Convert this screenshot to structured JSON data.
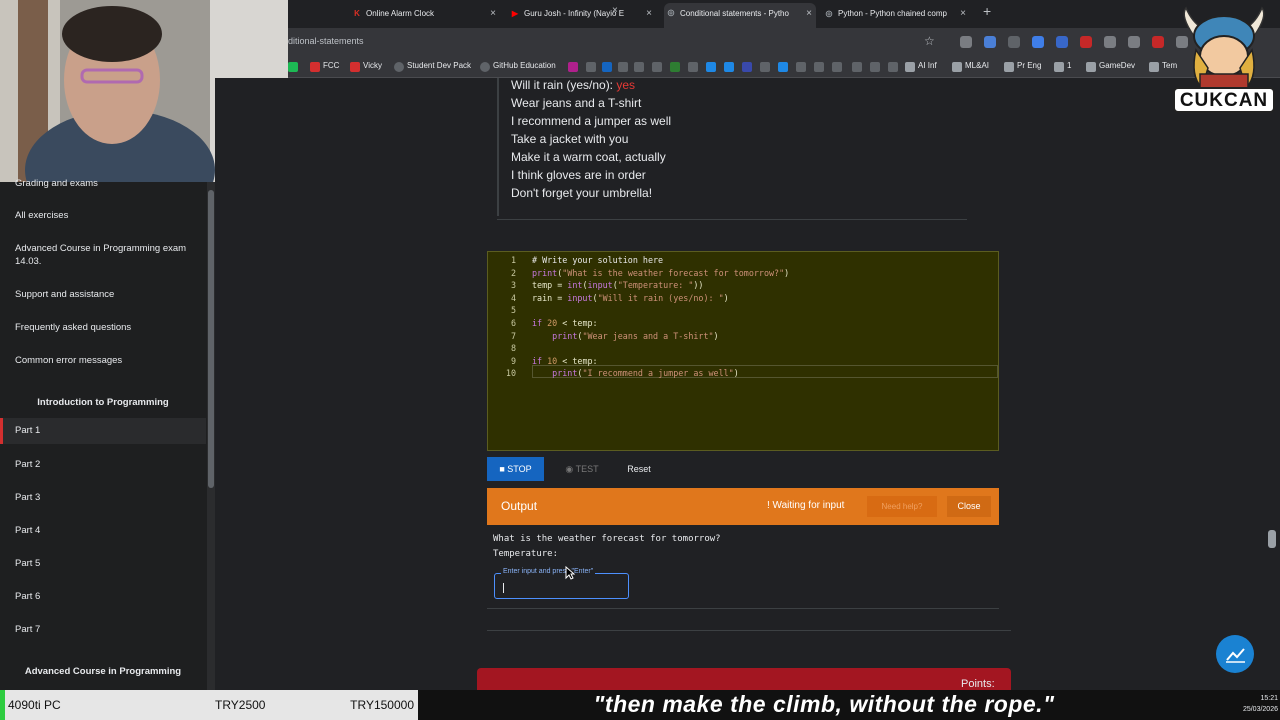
{
  "browser": {
    "tabs": [
      {
        "label": "Online Alarm Clock",
        "favicon": "K",
        "color": "#d93025"
      },
      {
        "label": "Guru Josh - Infinity (Nayio E",
        "favicon": "▶",
        "color": "#ff0000"
      },
      {
        "label": "Conditional statements - Pytho",
        "favicon": "◎",
        "color": "#9aa0a6"
      },
      {
        "label": "Python - Python chained comp",
        "favicon": "◎",
        "color": "#9aa0a6"
      }
    ],
    "close_glyph": "×",
    "new_tab": "+",
    "url": "ditional-statements",
    "star": "☆",
    "bookmarks": [
      "FCC",
      "Vicky",
      "Student Dev Pack",
      "GitHub Education",
      "AI Inf",
      "ML&AI",
      "Pr Eng",
      "1",
      "GameDev",
      "Tem"
    ]
  },
  "sidebar": {
    "items_top": [
      {
        "label": "Grading and exams"
      },
      {
        "label": "All exercises"
      },
      {
        "label": "Advanced Course in Programming exam 14.03."
      },
      {
        "label": "Support and assistance"
      },
      {
        "label": "Frequently asked questions"
      },
      {
        "label": "Common error messages"
      }
    ],
    "section_title": "Introduction to Programming",
    "parts": [
      "Part 1",
      "Part 2",
      "Part 3",
      "Part 4",
      "Part 5",
      "Part 6",
      "Part 7"
    ],
    "section_title_2": "Advanced Course in Programming"
  },
  "sample_output": {
    "prompt_line": "Will it rain (yes/no): ",
    "prompt_answer": "yes",
    "lines": [
      "Wear jeans and a T-shirt",
      "I recommend a jumper as well",
      "Take a jacket with you",
      "Make it a warm coat, actually",
      "I think gloves are in order",
      "Don't forget your umbrella!"
    ]
  },
  "editor": {
    "line_numbers": [
      "1",
      "2",
      "3",
      "4",
      "5",
      "6",
      "7",
      "8",
      "9",
      "10"
    ]
  },
  "controls": {
    "stop": "STOP",
    "test": "TEST",
    "reset": "Reset"
  },
  "output": {
    "title": "Output",
    "status": "! Waiting for input",
    "need_help": "Need help?",
    "close": "Close",
    "lines": [
      "What is the weather forecast for tomorrow?",
      "Temperature:"
    ],
    "input_label": "Enter input and press \"Enter\""
  },
  "next_card": {
    "points_label": "Points:"
  },
  "logo": {
    "text": "CUKCAN"
  },
  "overlay": {
    "box1": "4090ti PC",
    "box2": "TRY2500",
    "box3": "TRY150000",
    "caption": "\"then make the climb, without the rope.\"",
    "time": "15:21",
    "date": "25/03/2026"
  }
}
